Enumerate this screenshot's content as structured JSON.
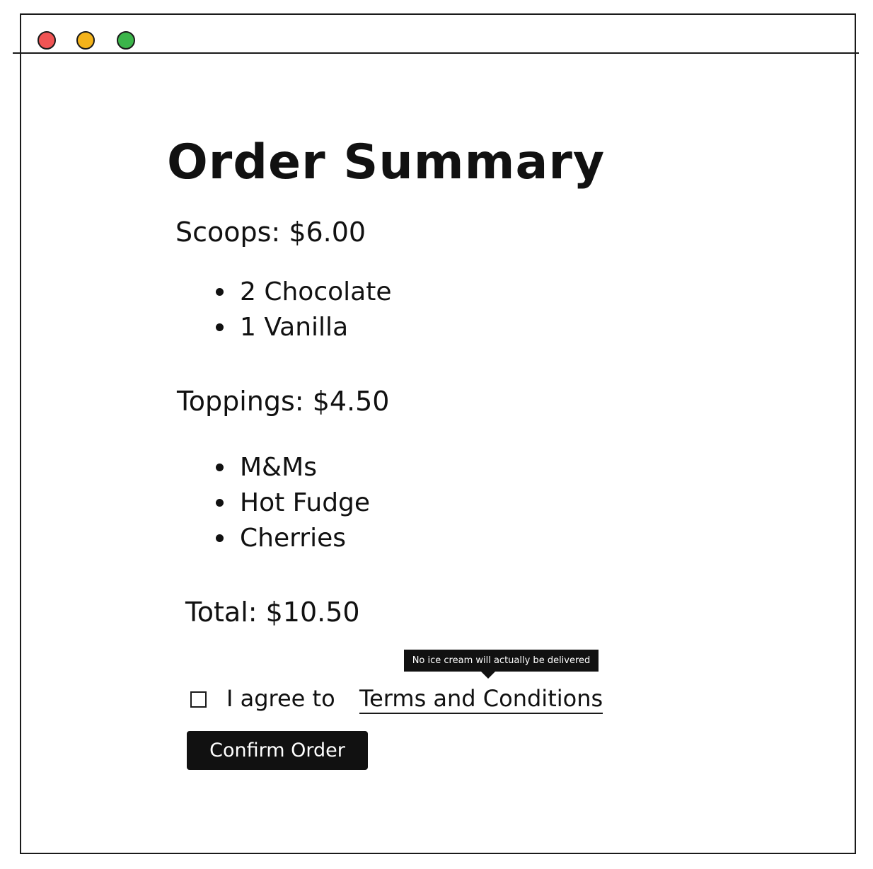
{
  "window": {
    "controls": {
      "close": "close-dot",
      "minimize": "minimize-dot",
      "maximize": "maximize-dot"
    },
    "control_colors": {
      "close": "#f05454",
      "minimize": "#f4b31a",
      "maximize": "#3bb54a"
    }
  },
  "order": {
    "title": "Order Summary",
    "scoops": {
      "heading": "Scoops: $6.00",
      "items": [
        "2 Chocolate",
        "1 Vanilla"
      ]
    },
    "toppings": {
      "heading": "Toppings: $4.50",
      "items": [
        "M&Ms",
        "Hot Fudge",
        "Cherries"
      ]
    },
    "total": "Total: $10.50"
  },
  "agreement": {
    "checked": false,
    "prefix": "I agree to",
    "link_label": "Terms and Conditions",
    "tooltip": "No ice cream will actually be delivered"
  },
  "actions": {
    "confirm_label": "Confirm Order",
    "button_color": "#111111"
  }
}
